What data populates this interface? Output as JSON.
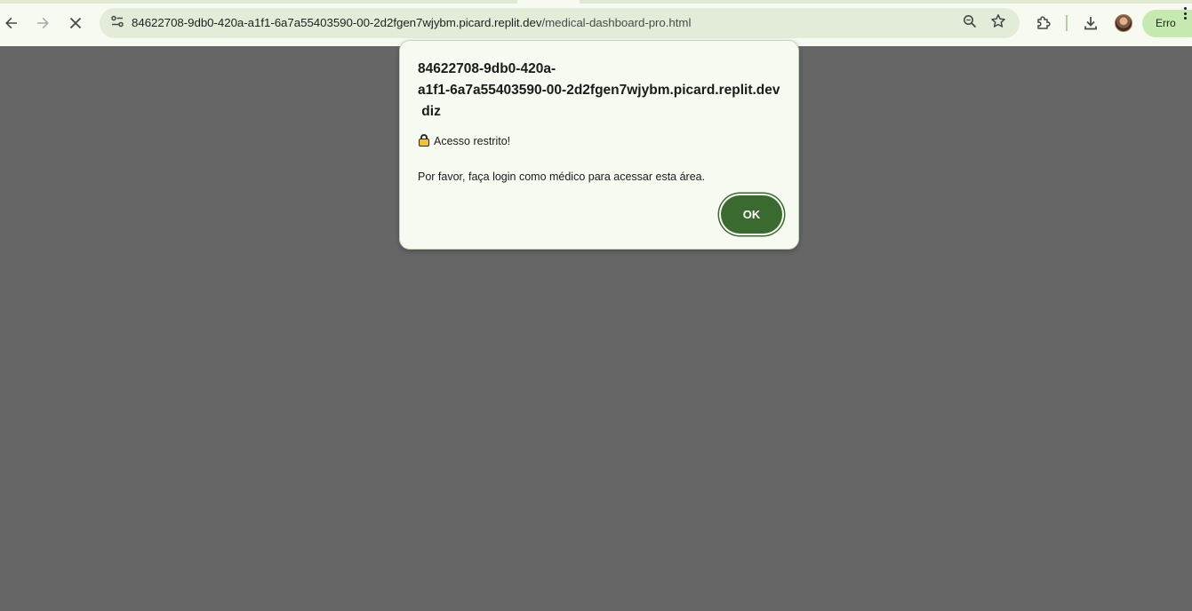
{
  "browser": {
    "url_host": "84622708-9db0-420a-a1f1-6a7a55403590-00-2d2fgen7wjybm.picard.replit.dev",
    "url_path": "/medical-dashboard-pro.html",
    "profile_label": "Erro",
    "icons": {
      "back": "arrow-left-icon",
      "forward": "arrow-right-icon",
      "stop": "close-icon",
      "site_info": "tune-icon",
      "zoom": "zoom-icon",
      "bookmark": "star-icon",
      "extensions": "puzzle-icon",
      "downloads": "download-icon",
      "menu": "kebab-icon"
    }
  },
  "dialog": {
    "title": "84622708-9db0-420a-a1f1-6a7a55403590-00-2d2fgen7wjybm.picard.replit.dev diz",
    "title_line1": "84622708-9db0-420a-",
    "title_line2": "a1f1-6a7a55403590-00-2d2fgen7wjybm.picard.replit.dev",
    "title_line3": " diz",
    "message_line1": "Acesso restrito!",
    "message_line2": "Por favor, faça login como médico para acessar esta área.",
    "ok_label": "OK",
    "lock_icon": "lock-emoji-icon"
  },
  "colors": {
    "page_overlay": "#666666",
    "dialog_bg": "#f6faf1",
    "ok_button": "#3a6a2f",
    "profile_pill": "#c4eab0",
    "omnibox": "#e3ecd9"
  }
}
